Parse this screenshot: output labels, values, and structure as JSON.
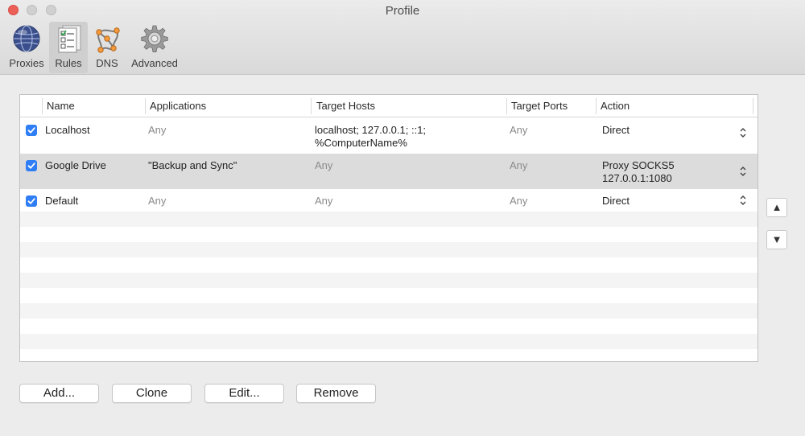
{
  "window": {
    "title": "Profile"
  },
  "toolbar": {
    "items": [
      {
        "label": "Proxies",
        "icon": "globe-icon"
      },
      {
        "label": "Rules",
        "icon": "checklist-icon",
        "active": true
      },
      {
        "label": "DNS",
        "icon": "network-nodes-icon"
      },
      {
        "label": "Advanced",
        "icon": "gear-icon"
      }
    ]
  },
  "table": {
    "columns": [
      "Name",
      "Applications",
      "Target Hosts",
      "Target Ports",
      "Action"
    ],
    "rows": [
      {
        "checked": true,
        "name": "Localhost",
        "applications": "Any",
        "hosts": [
          "localhost; 127.0.0.1; ::1;",
          "%ComputerName%"
        ],
        "ports": "Any",
        "action": [
          "Direct"
        ]
      },
      {
        "checked": true,
        "name": "Google Drive",
        "applications": "\"Backup and Sync\"",
        "hosts": [
          "Any"
        ],
        "ports": "Any",
        "action": [
          "Proxy SOCKS5",
          "127.0.0.1:1080"
        ]
      },
      {
        "checked": true,
        "name": "Default",
        "applications": "Any",
        "hosts": [
          "Any"
        ],
        "ports": "Any",
        "action": [
          "Direct"
        ]
      }
    ]
  },
  "side": {
    "up": "▲",
    "down": "▼"
  },
  "buttons": {
    "add": "Add...",
    "clone": "Clone",
    "edit": "Edit...",
    "remove": "Remove"
  },
  "colors": {
    "accent": "#2f7ef5",
    "close": "#ec5f57"
  }
}
